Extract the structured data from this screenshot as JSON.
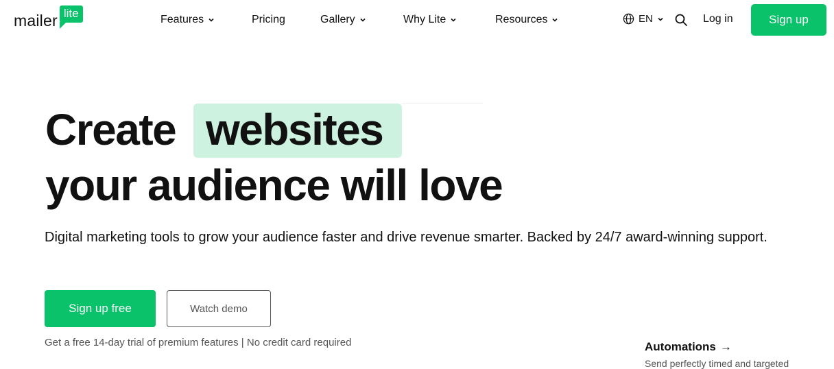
{
  "nav": {
    "logo_word": "mailer",
    "logo_badge": "lite",
    "menu": [
      "Features",
      "Pricing",
      "Gallery",
      "Why Lite",
      "Resources"
    ],
    "lang": "EN",
    "login": "Log in",
    "signup": "Sign up"
  },
  "hero": {
    "headline_start": "Create",
    "headline_highlight": "websites",
    "headline_end": "your audience will love",
    "subtitle": "Digital marketing tools to grow your audience faster and drive revenue smarter. Backed by 24/7 award-winning support.",
    "primary_cta": "Sign up free",
    "secondary_cta": "Watch demo",
    "note": "Get a free 14-day trial of premium features | No credit card required"
  },
  "side": {
    "title": "Automations",
    "arrow": "→",
    "subtitle": "Send perfectly timed and targeted"
  },
  "colors": {
    "brand_green": "#09c269",
    "highlight_green": "#cdf2e0"
  }
}
